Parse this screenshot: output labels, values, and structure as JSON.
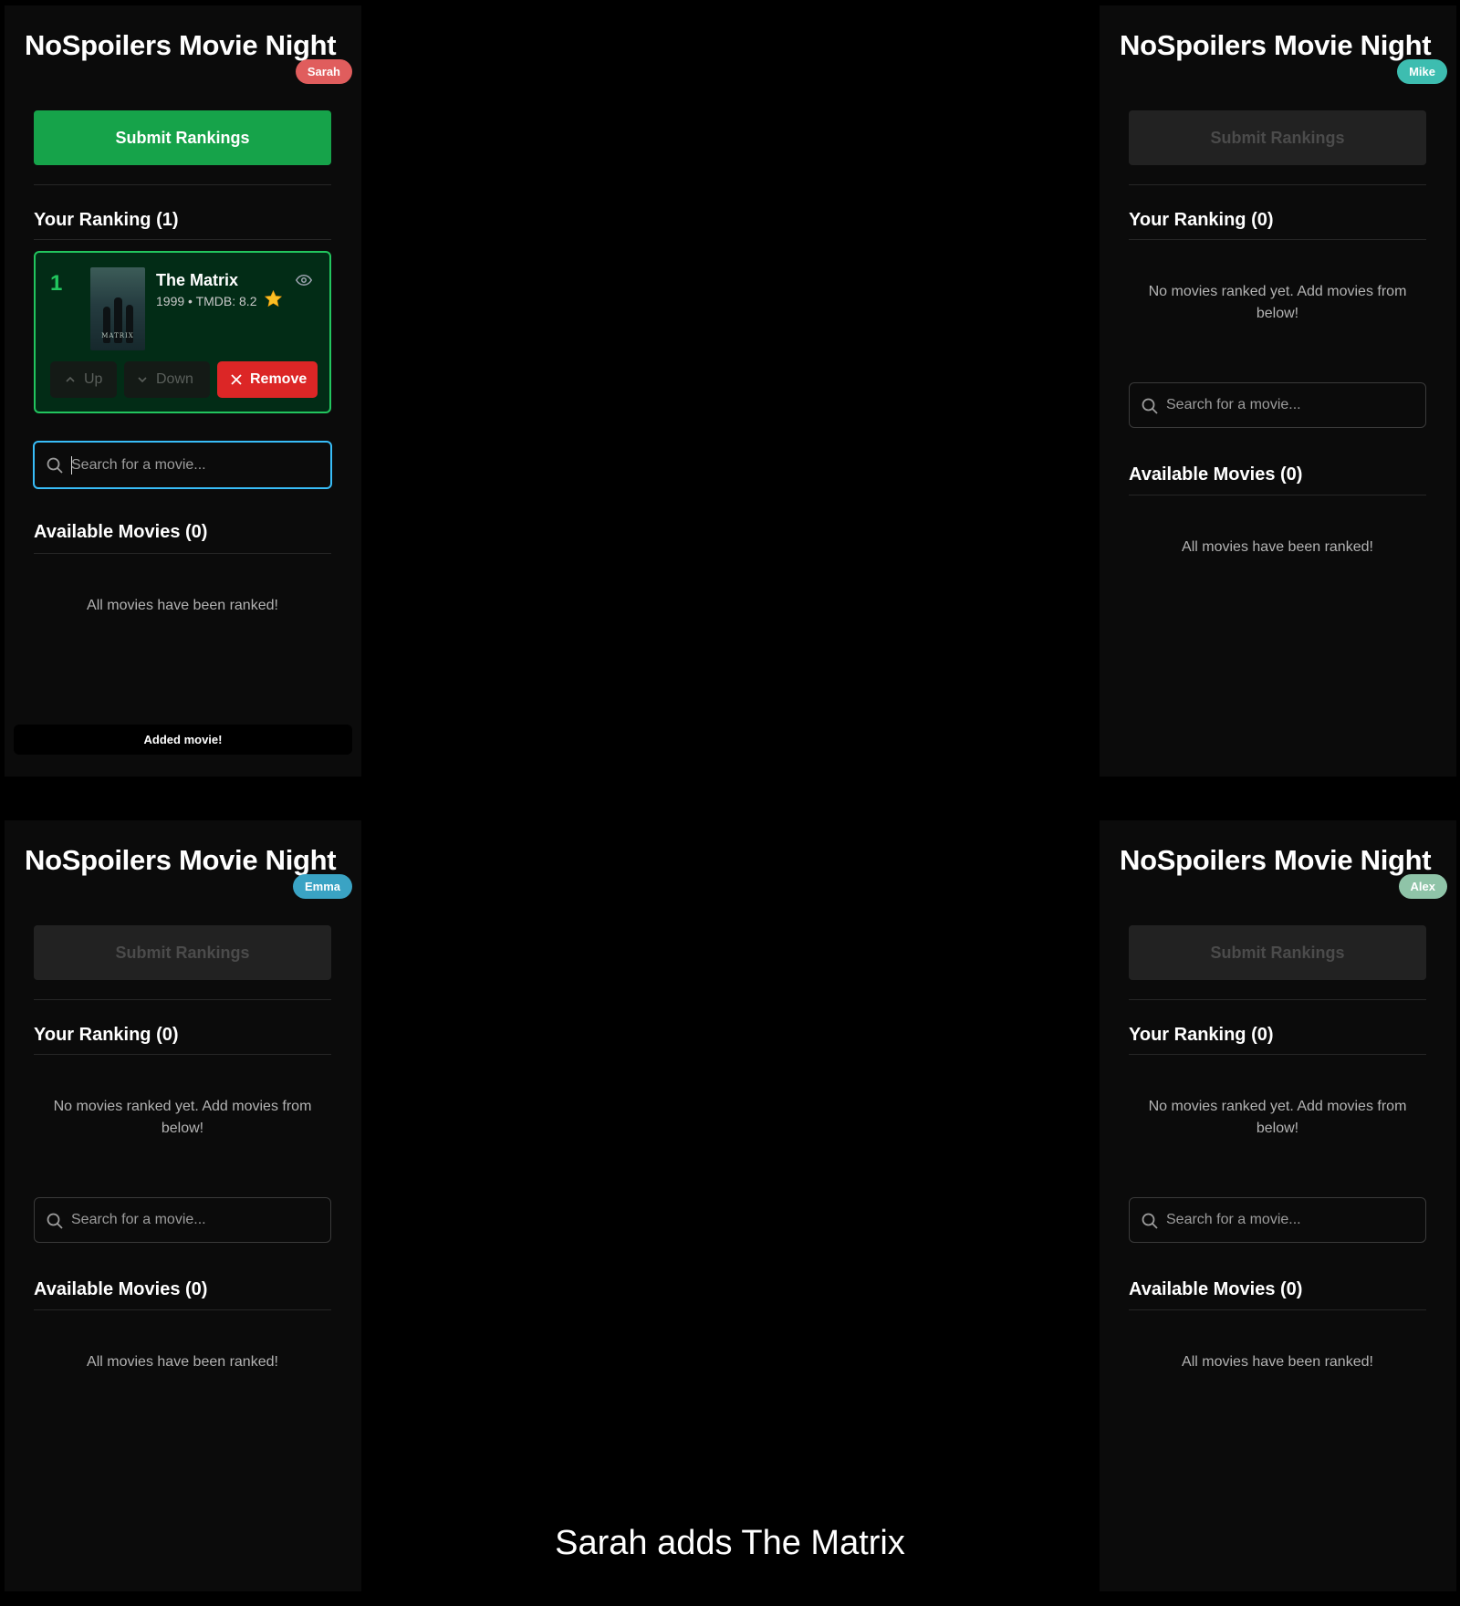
{
  "app_title": "NoSpoilers Movie Night",
  "caption": "Sarah adds The Matrix",
  "labels": {
    "submit": "Submit Rankings",
    "search_placeholder": "Search for a movie...",
    "no_movies": "No movies ranked yet. Add movies from below!",
    "all_ranked": "All movies have been ranked!"
  },
  "panels": [
    {
      "user": "Sarah",
      "badge_color": "#e05d5d",
      "submit_enabled": true,
      "ranking_heading": "Your Ranking (1)",
      "available_heading": "Available Movies (0)",
      "ranked_movies": [
        {
          "rank": "1",
          "title": "The Matrix",
          "meta": "1999 • TMDB: 8.2",
          "poster_text": "MATRIX",
          "buttons": {
            "up": "Up",
            "down": "Down",
            "remove": "Remove"
          }
        }
      ],
      "toast": "Added movie!"
    },
    {
      "user": "Mike",
      "badge_color": "#3dbdb0",
      "submit_enabled": false,
      "ranking_heading": "Your Ranking (0)",
      "available_heading": "Available Movies (0)"
    },
    {
      "user": "Emma",
      "badge_color": "#3aa3c4",
      "submit_enabled": false,
      "ranking_heading": "Your Ranking (0)",
      "available_heading": "Available Movies (0)"
    },
    {
      "user": "Alex",
      "badge_color": "#8fc4a8",
      "submit_enabled": false,
      "ranking_heading": "Your Ranking (0)",
      "available_heading": "Available Movies (0)"
    }
  ]
}
